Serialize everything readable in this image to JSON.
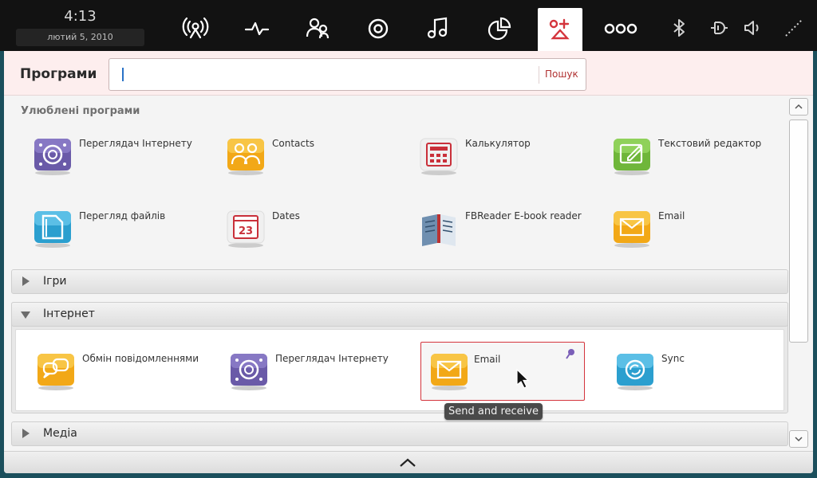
{
  "clock": {
    "time": "4:13",
    "date": "лютий  5, 2010"
  },
  "panel": {
    "icons": [
      "network-activity-icon",
      "pulse-icon",
      "contacts-icon",
      "target-icon",
      "music-icon",
      "pie-chart-icon",
      "add-application-icon",
      "more-icon"
    ],
    "active_icon": "add-application-icon",
    "status_icons": [
      "bluetooth-icon",
      "battery-icon",
      "volume-icon",
      "signal-icon"
    ]
  },
  "header": {
    "title": "Програми",
    "search_placeholder": "",
    "search_button": "Пошук"
  },
  "favorites": {
    "title": "Улюблені програми",
    "apps": [
      {
        "name": "Переглядач Інтернету",
        "icon": "web-browser-icon"
      },
      {
        "name": "Contacts",
        "icon": "contacts-app-icon"
      },
      {
        "name": "Калькулятор",
        "icon": "calculator-icon"
      },
      {
        "name": "Текстовий редактор",
        "icon": "text-editor-icon"
      },
      {
        "name": "Перегляд файлів",
        "icon": "file-viewer-icon"
      },
      {
        "name": "Dates",
        "icon": "calendar-icon",
        "badge": "23"
      },
      {
        "name": "FBReader E-book reader",
        "icon": "ebook-reader-icon"
      },
      {
        "name": "Email",
        "icon": "email-icon"
      }
    ]
  },
  "categories": {
    "games": "Ігри",
    "internet": "Інтернет",
    "media": "Медіа"
  },
  "internet_apps": [
    {
      "name": "Обмін повідомленнями",
      "icon": "messaging-icon"
    },
    {
      "name": "Переглядач Інтернету",
      "icon": "web-browser-icon"
    },
    {
      "name": "Email",
      "icon": "email-icon",
      "selected": true
    },
    {
      "name": "Sync",
      "icon": "sync-icon"
    }
  ],
  "tooltip": "Send and receive",
  "colors": {
    "accent": "#d4343c",
    "panel_bg": "#121212",
    "header_bg": "#fdeeee"
  }
}
